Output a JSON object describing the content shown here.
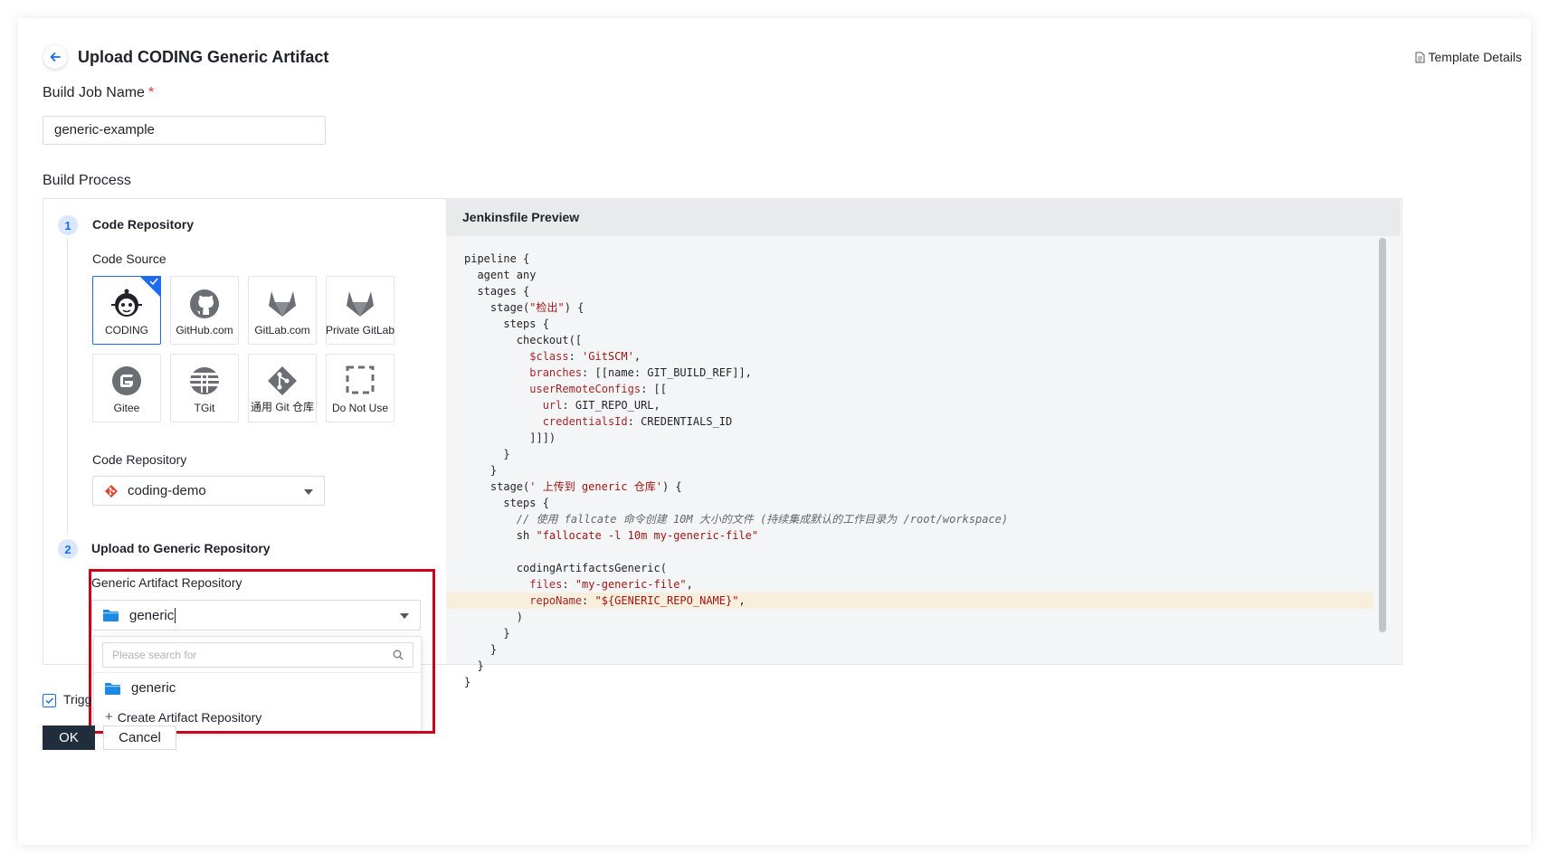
{
  "header": {
    "title": "Upload CODING Generic Artifact",
    "template_link": "Template Details"
  },
  "build_job": {
    "label": "Build Job Name",
    "required_mark": "*",
    "value": "generic-example"
  },
  "build_process": {
    "label": "Build Process"
  },
  "step1": {
    "number": "1",
    "title": "Code Repository",
    "code_source_label": "Code Source",
    "sources": [
      {
        "label": "CODING",
        "icon": "coding-icon",
        "selected": true
      },
      {
        "label": "GitHub.com",
        "icon": "github-icon",
        "selected": false
      },
      {
        "label": "GitLab.com",
        "icon": "gitlab-icon",
        "selected": false
      },
      {
        "label": "Private GitLab",
        "icon": "gitlab-icon",
        "selected": false
      },
      {
        "label": "Gitee",
        "icon": "gitee-icon",
        "selected": false
      },
      {
        "label": "TGit",
        "icon": "tgit-icon",
        "selected": false
      },
      {
        "label": "通用 Git 仓库",
        "icon": "git-icon",
        "selected": false
      },
      {
        "label": "Do Not Use",
        "icon": "dashed-square-icon",
        "selected": false
      }
    ],
    "code_repository_label": "Code Repository",
    "code_repository_value": "coding-demo"
  },
  "step2": {
    "number": "2",
    "title": "Upload to Generic Repository",
    "artifact_label": "Generic Artifact Repository",
    "artifact_value": "generic",
    "search_placeholder": "Please search for",
    "options": [
      {
        "label": "generic"
      }
    ],
    "create_label": "Create Artifact Repository"
  },
  "trigger": {
    "label": "Trigg"
  },
  "buttons": {
    "ok": "OK",
    "cancel": "Cancel"
  },
  "preview": {
    "title": "Jenkinsfile Preview",
    "lines": [
      "pipeline {",
      "  agent any",
      "  stages {",
      "    stage(\"检出\") {",
      "      steps {",
      "        checkout([",
      "          $class: 'GitSCM',",
      "          branches: [[name: GIT_BUILD_REF]],",
      "          userRemoteConfigs: [[",
      "            url: GIT_REPO_URL,",
      "            credentialsId: CREDENTIALS_ID",
      "          ]]])",
      "      }",
      "    }",
      "    stage(' 上传到 generic 仓库') {",
      "      steps {",
      "        // 使用 fallcate 命令创建 10M 大小的文件 (持续集成默认的工作目录为 /root/workspace)",
      "        sh \"fallocate -l 10m my-generic-file\"",
      "",
      "        codingArtifactsGeneric(",
      "          files: \"my-generic-file\",",
      "          repoName: \"${GENERIC_REPO_NAME}\",",
      "        )",
      "      }",
      "    }",
      "  }",
      "}"
    ],
    "highlighted_line": 21
  },
  "colors": {
    "accent": "#1c6cf0",
    "highlight_frame": "#d0021b",
    "primary_button": "#1f2d3d"
  }
}
